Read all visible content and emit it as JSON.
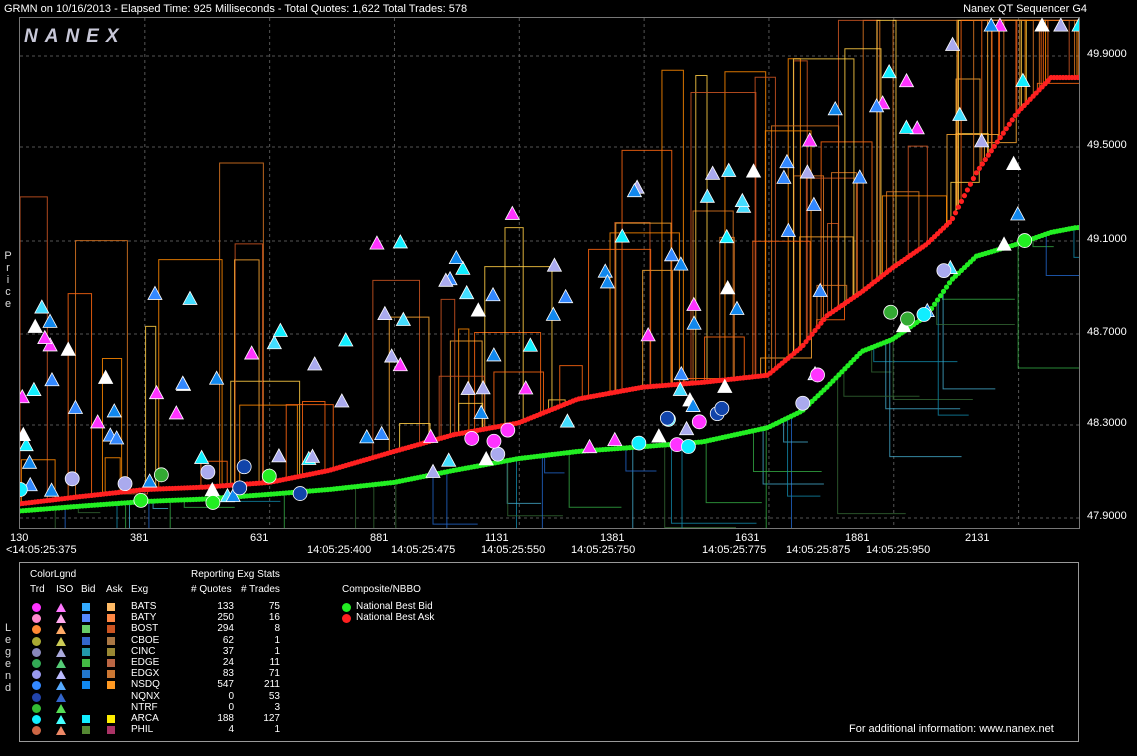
{
  "header": {
    "left": "GRMN on 10/16/2013  -  Elapsed Time: 925 Milliseconds  -  Total Quotes: 1,622  Total Trades: 578",
    "right": "Nanex QT Sequencer G4"
  },
  "logo": "NANEX",
  "axis": {
    "ylabel": "Price",
    "legend_label": "Legend",
    "y_ticks": [
      "49.9000",
      "49.5000",
      "49.1000",
      "48.7000",
      "48.3000",
      "47.9000"
    ],
    "x_ticks": [
      "130",
      "381",
      "631",
      "881",
      "1131",
      "1381",
      "1631",
      "1881",
      "2131"
    ],
    "time_ticks": [
      "<14:05:25:375",
      "14:05:25:400",
      "14:05:25:475",
      "14:05:25:550",
      "14:05:25:750",
      "14:05:25:775",
      "14:05:25:875",
      "14:05:25:950"
    ]
  },
  "legend": {
    "colorlgnd_title": "ColorLgnd",
    "col_headers": [
      "Trd",
      "ISO",
      "Bid",
      "Ask",
      "Exg"
    ],
    "stats_title": "Reporting Exg Stats",
    "stats_headers": [
      "# Quotes",
      "# Trades"
    ],
    "composite_title": "Composite/NBBO",
    "nbbo": [
      {
        "label": "National Best Bid",
        "color": "#22ee22"
      },
      {
        "label": "National Best Ask",
        "color": "#ff2020"
      }
    ],
    "exchanges": [
      {
        "name": "BATS",
        "trd": "#ff33ff",
        "iso": "#ff77ff",
        "bid": "#33aaff",
        "ask": "#ffbb66",
        "quotes": "133",
        "trades": "75"
      },
      {
        "name": "BATY",
        "trd": "#ff88cc",
        "iso": "#ffaaee",
        "bid": "#5588ff",
        "ask": "#ff8844",
        "quotes": "250",
        "trades": "16"
      },
      {
        "name": "BOST",
        "trd": "#ff8833",
        "iso": "#ffaa66",
        "bid": "#66cc66",
        "ask": "#cc5522",
        "quotes": "294",
        "trades": "8"
      },
      {
        "name": "CBOE",
        "trd": "#aaaa33",
        "iso": "#cccc55",
        "bid": "#3366cc",
        "ask": "#aa7744",
        "quotes": "62",
        "trades": "1"
      },
      {
        "name": "CINC",
        "trd": "#8888bb",
        "iso": "#aaaadd",
        "bid": "#2299aa",
        "ask": "#998833",
        "quotes": "37",
        "trades": "1"
      },
      {
        "name": "EDGE",
        "trd": "#33aa55",
        "iso": "#55cc77",
        "bid": "#44bb44",
        "ask": "#bb6644",
        "quotes": "24",
        "trades": "11"
      },
      {
        "name": "EDGX",
        "trd": "#9999ee",
        "iso": "#bbbbff",
        "bid": "#2277cc",
        "ask": "#cc7733",
        "quotes": "83",
        "trades": "71"
      },
      {
        "name": "NSDQ",
        "trd": "#3388ff",
        "iso": "#55aaff",
        "bid": "#1188ee",
        "ask": "#ff9922",
        "quotes": "547",
        "trades": "211"
      },
      {
        "name": "NQNX",
        "trd": "#2244aa",
        "iso": "#3366cc",
        "bid": "",
        "ask": "",
        "quotes": "0",
        "trades": "53"
      },
      {
        "name": "NTRF",
        "trd": "#33bb33",
        "iso": "#55dd55",
        "bid": "",
        "ask": "",
        "quotes": "0",
        "trades": "3"
      },
      {
        "name": "ARCA",
        "trd": "#11eeff",
        "iso": "#44ffff",
        "bid": "#11eeff",
        "ask": "#ffee00",
        "quotes": "188",
        "trades": "127"
      },
      {
        "name": "PHIL",
        "trd": "#cc6644",
        "iso": "#ee8866",
        "bid": "#558833",
        "ask": "#aa3366",
        "quotes": "4",
        "trades": "1"
      }
    ],
    "footer": "For additional information: www.nanex.net"
  },
  "chart_data": {
    "type": "scatter",
    "title": "GRMN on 10/16/2013",
    "xlabel": "",
    "ylabel": "Price",
    "xlim": [
      130,
      2260
    ],
    "ylim": [
      47.85,
      50.0
    ],
    "grid": true,
    "series": [
      {
        "name": "National Best Bid",
        "color": "#22ee22",
        "x": [
          130,
          250,
          381,
          500,
          631,
          750,
          881,
          1000,
          1131,
          1250,
          1381,
          1500,
          1631,
          1700,
          1750,
          1820,
          1881,
          1950,
          2000,
          2050,
          2131,
          2200,
          2250
        ],
        "y": [
          47.93,
          47.95,
          47.97,
          47.98,
          48.0,
          48.02,
          48.05,
          48.1,
          48.15,
          48.18,
          48.2,
          48.22,
          48.28,
          48.35,
          48.45,
          48.6,
          48.65,
          48.75,
          48.9,
          49.0,
          49.05,
          49.1,
          49.12
        ]
      },
      {
        "name": "National Best Ask",
        "color": "#ff2020",
        "x": [
          130,
          250,
          381,
          500,
          631,
          750,
          881,
          1000,
          1131,
          1250,
          1381,
          1500,
          1631,
          1700,
          1750,
          1820,
          1881,
          1950,
          2000,
          2050,
          2131,
          2200,
          2250
        ],
        "y": [
          47.96,
          47.99,
          48.02,
          48.03,
          48.05,
          48.1,
          48.18,
          48.25,
          48.3,
          48.4,
          48.45,
          48.47,
          48.5,
          48.62,
          48.75,
          48.85,
          48.95,
          49.05,
          49.15,
          49.35,
          49.6,
          49.75,
          49.75
        ]
      }
    ]
  }
}
